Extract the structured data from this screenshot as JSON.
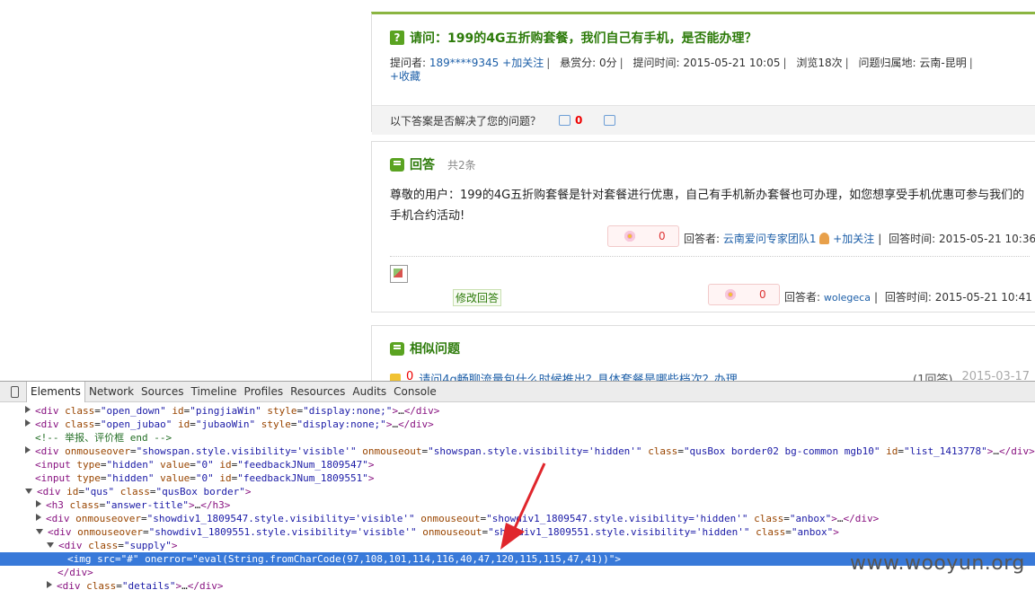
{
  "question": {
    "badge": "?",
    "title": "请问：199的4G五折购套餐，我们自己有手机，是否能办理？",
    "asker_label": "提问者:",
    "asker": "189****9345",
    "follow": "+加关注",
    "reward_label": "悬赏分:",
    "reward": "0分",
    "time_label": "提问时间:",
    "time": "2015-05-21 10:05",
    "views": "浏览18次",
    "region_label": "问题归属地:",
    "region": "云南-昆明",
    "favorite": "+收藏",
    "feedback_text": "以下答案是否解决了您的问题？",
    "up_count": "0"
  },
  "answers": {
    "title": "回答",
    "count": "共2条",
    "items": [
      {
        "text": "尊敬的用户：199的4G五折购套餐是针对套餐进行优惠，自己有手机新办套餐也可办理，如您想享受手机优惠可参与我们的手机合约活动!",
        "votes": "0",
        "by_label": "回答者:",
        "by": "云南爱问专家团队1",
        "follow": "+加关注",
        "time_label": "回答时间:",
        "time": "2015-05-21 10:36"
      },
      {
        "votes": "0",
        "by_label": "回答者:",
        "by": "wolegeca",
        "time_label": "回答时间:",
        "time": "2015-05-21 10:41",
        "edit": "修改回答"
      }
    ]
  },
  "similar": {
    "title": "相似问题",
    "items": [
      {
        "num": "0",
        "text": "请问4g畅聊流量包什么时候推出？具体套餐是哪些档次？办理",
        "count": "(1回答)",
        "date": "2015-03-17"
      }
    ]
  },
  "devtools": {
    "tabs": [
      "Elements",
      "Network",
      "Sources",
      "Timeline",
      "Profiles",
      "Resources",
      "Audits",
      "Console"
    ],
    "active_tab": "Elements"
  },
  "watermark": "www.wooyun.org",
  "colors": {
    "accent_green": "#2d7b0a",
    "link_blue": "#1d5fa8",
    "selection": "#3879d9",
    "arrow": "#e0262c"
  }
}
